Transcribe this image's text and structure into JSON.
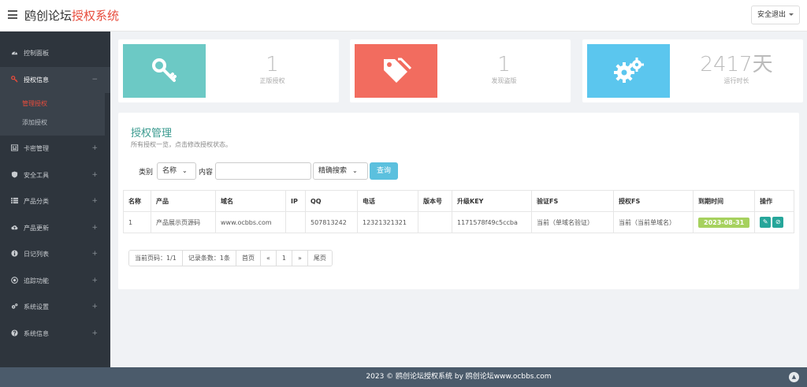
{
  "header": {
    "brand_main": "鸥创论坛",
    "brand_accent": "授权系统",
    "logout_label": "安全退出"
  },
  "sidebar": {
    "items": [
      {
        "label": "控制面板",
        "icon": "dashboard-icon"
      },
      {
        "label": "授权信息",
        "icon": "key-icon",
        "toggle": "−"
      },
      {
        "label": "卡密管理",
        "icon": "barcode-icon",
        "toggle": "+"
      },
      {
        "label": "安全工具",
        "icon": "shield-icon",
        "toggle": "+"
      },
      {
        "label": "产品分类",
        "icon": "list-icon",
        "toggle": "+"
      },
      {
        "label": "产品更新",
        "icon": "cloud-upload-icon",
        "toggle": "+"
      },
      {
        "label": "日记列表",
        "icon": "info-icon",
        "toggle": "+"
      },
      {
        "label": "追踪功能",
        "icon": "target-icon",
        "toggle": "+"
      },
      {
        "label": "系统设置",
        "icon": "gears-icon",
        "toggle": "+"
      },
      {
        "label": "系统信息",
        "icon": "question-icon",
        "toggle": "+"
      }
    ],
    "subitems": [
      "管理授权",
      "添加授权"
    ]
  },
  "stats": [
    {
      "value": "1",
      "label": "正版授权",
      "color": "#6cc9c5",
      "icon": "key-icon"
    },
    {
      "value": "1",
      "label": "发现盗版",
      "color": "#f26c5f",
      "icon": "tags-icon"
    },
    {
      "value": "2417天",
      "label": "运行时长",
      "color": "#5bc6ee",
      "icon": "gears-icon"
    }
  ],
  "panel": {
    "title": "授权管理",
    "subtitle": "所有授权一览，点击修改授权状态。"
  },
  "filter": {
    "category_label": "类别",
    "category_value": "名称",
    "content_label": "内容",
    "mode_value": "精确搜索",
    "search_button": "查询"
  },
  "table": {
    "headers": [
      "名称",
      "产品",
      "域名",
      "IP",
      "QQ",
      "电话",
      "版本号",
      "升级KEY",
      "验证FS",
      "授权FS",
      "到期时间",
      "操作"
    ],
    "rows": [
      [
        "1",
        "产品展示页源码",
        "www.ocbbs.com",
        "",
        "507813242",
        "12321321321",
        "",
        "1171578f49c5ccba",
        "当前（单域名验证）",
        "当前（当前单域名）",
        "2023-08-31"
      ]
    ]
  },
  "pagination": {
    "current": "当前页码：1/1",
    "records": "记录条数：1条",
    "first": "首页",
    "prev": "«",
    "page": "1",
    "next": "»",
    "last": "尾页"
  },
  "footer": {
    "text": "2023 © 鸥创论坛授权系统 by 鸥创论坛www.ocbbs.com"
  }
}
